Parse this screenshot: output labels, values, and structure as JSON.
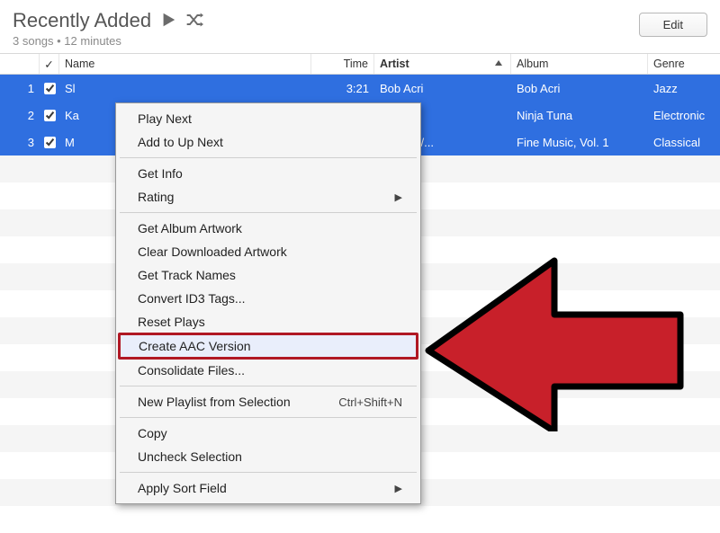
{
  "header": {
    "title": "Recently Added",
    "subtitle": "3 songs • 12 minutes",
    "edit_label": "Edit"
  },
  "columns": {
    "check": "✓",
    "name": "Name",
    "time": "Time",
    "artist": "Artist",
    "album": "Album",
    "genre": "Genre"
  },
  "rows": [
    {
      "num": "1",
      "name": "Sl",
      "time": "3:21",
      "artist": "Bob Acri",
      "album": "Bob Acri",
      "genre": "Jazz"
    },
    {
      "num": "2",
      "name": "Ka",
      "time": "",
      "artist": "",
      "album": "Ninja Tuna",
      "genre": "Electronic"
    },
    {
      "num": "3",
      "name": "M",
      "time": "",
      "artist": "oltzman/...",
      "album": "Fine Music, Vol. 1",
      "genre": "Classical"
    }
  ],
  "menu": {
    "play_next": "Play Next",
    "add_up_next": "Add to Up Next",
    "get_info": "Get Info",
    "rating": "Rating",
    "get_album_artwork": "Get Album Artwork",
    "clear_downloaded_artwork": "Clear Downloaded Artwork",
    "get_track_names": "Get Track Names",
    "convert_id3": "Convert ID3 Tags...",
    "reset_plays": "Reset Plays",
    "create_aac": "Create AAC Version",
    "consolidate": "Consolidate Files...",
    "new_playlist": "New Playlist from Selection",
    "new_playlist_shortcut": "Ctrl+Shift+N",
    "copy": "Copy",
    "uncheck": "Uncheck Selection",
    "apply_sort": "Apply Sort Field"
  }
}
